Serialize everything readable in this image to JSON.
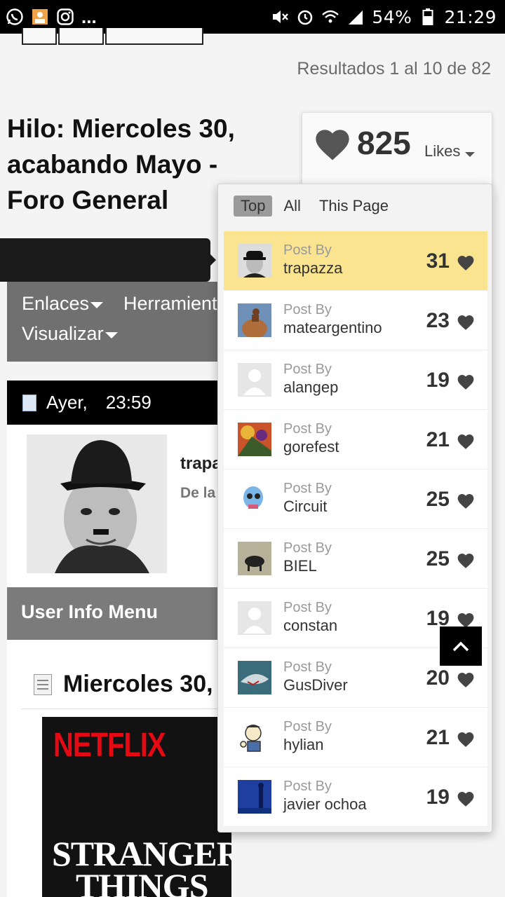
{
  "status_bar": {
    "battery": "54%",
    "time": "21:29",
    "more": "..."
  },
  "page": {
    "results": "Resultados 1 al 10 de 82",
    "thread_title": "Hilo: Miercoles 30, acabando Mayo - Foro General"
  },
  "likes": {
    "count": "825",
    "label": "Likes",
    "tabs": [
      "Top",
      "All",
      "This Page"
    ],
    "active_tab": "Top",
    "post_by_label": "Post By",
    "entries": [
      {
        "user": "trapazza",
        "count": "31",
        "avatar": "chaplin-avatar",
        "highlight": true
      },
      {
        "user": "mateargentino",
        "count": "23",
        "avatar": "bird-avatar"
      },
      {
        "user": "alangep",
        "count": "19",
        "avatar": "default-avatar"
      },
      {
        "user": "gorefest",
        "count": "21",
        "avatar": "painting-avatar"
      },
      {
        "user": "Circuit",
        "count": "25",
        "avatar": "skull-avatar"
      },
      {
        "user": "BIEL",
        "count": "25",
        "avatar": "bull-avatar"
      },
      {
        "user": "constan",
        "count": "19",
        "avatar": "default-avatar"
      },
      {
        "user": "GusDiver",
        "count": "20",
        "avatar": "shark-avatar"
      },
      {
        "user": "hylian",
        "count": "21",
        "avatar": "vaultboy-avatar"
      },
      {
        "user": "javier ochoa",
        "count": "19",
        "avatar": "blue-figure-avatar"
      }
    ]
  },
  "menu": {
    "enlaces": "Enlaces",
    "herramientas": "Herramient",
    "visualizar": "Visualizar"
  },
  "post": {
    "date": "Ayer,",
    "time": "23:59",
    "author": "trapa",
    "author_sub": "De la",
    "user_info_menu": "User Info Menu",
    "title": "Miercoles 30,",
    "poster_brand": "NETFLIX",
    "poster_title_1": "STRANGER",
    "poster_title_2": "THINGS"
  },
  "colors": {
    "highlight": "#fbe48f",
    "netflix_red": "#e50914",
    "menu_grey": "#707070"
  }
}
